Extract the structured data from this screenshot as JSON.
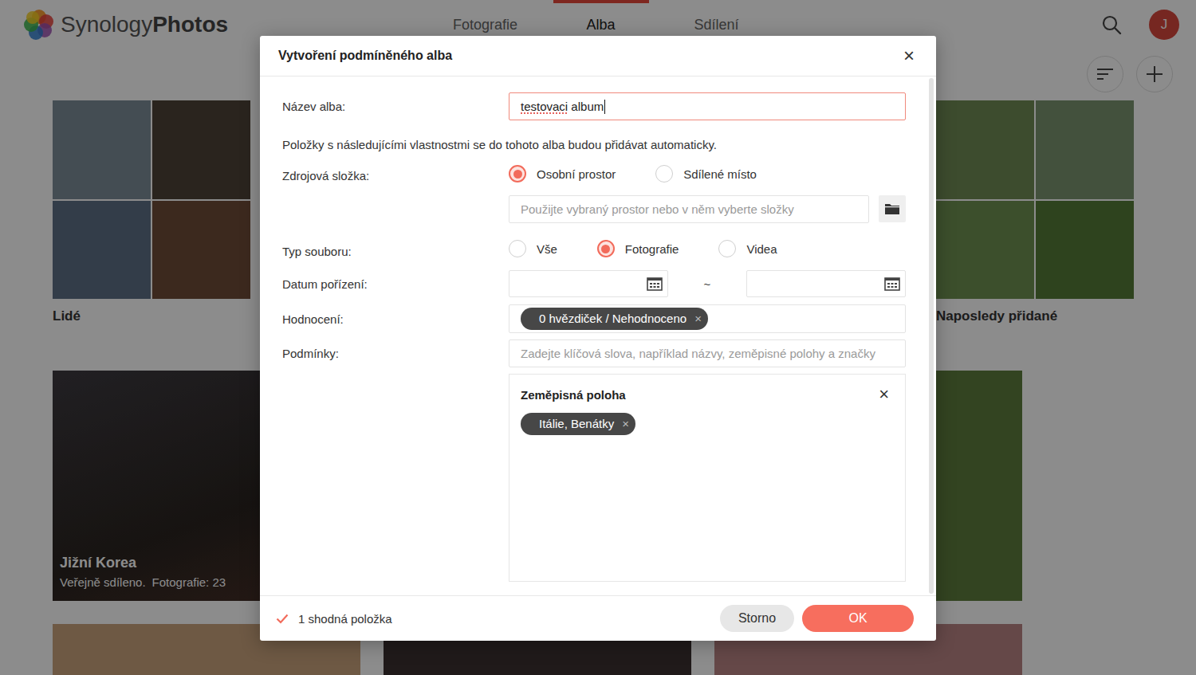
{
  "app": {
    "logo_light": "Synology",
    "logo_bold": "Photos",
    "avatar": "J"
  },
  "tabs": [
    {
      "label": "Fotografie",
      "selected": false
    },
    {
      "label": "Alba",
      "selected": true
    },
    {
      "label": "Sdílení",
      "selected": false
    }
  ],
  "albums": {
    "top": [
      {
        "kind": "mosaic",
        "title": "Lidé"
      },
      {
        "kind": "hidden"
      },
      {
        "kind": "hidden"
      },
      {
        "kind": "hidden"
      },
      {
        "kind": "mosaic",
        "title": "Naposledy přidané"
      }
    ],
    "cards": [
      {
        "kind": "cover",
        "title": "Jižní Korea",
        "meta": "Veřejně sdíleno.",
        "count": "Fotografie: 23"
      },
      {
        "kind": "hidden"
      },
      {
        "kind": "photo"
      },
      {
        "kind": "photo"
      },
      {
        "kind": "photo"
      },
      {
        "kind": "photo"
      }
    ]
  },
  "dialog": {
    "title": "Vytvoření podmíněného alba",
    "close": "×",
    "name": {
      "label": "Název alba:",
      "focused": true,
      "value": [
        {
          "text": "testovaci",
          "misspelled": true
        },
        {
          "text": " album",
          "misspelled": false
        }
      ]
    },
    "description": "Položky s následujícími vlastnostmi se do tohoto alba budou přidávat automaticky.",
    "source": {
      "label": "Zdrojová složka:",
      "options": [
        {
          "label": "Osobní prostor",
          "selected": true
        },
        {
          "label": "Sdílené místo",
          "selected": false
        }
      ],
      "folder_placeholder": "Použijte vybraný prostor nebo v něm vyberte složky"
    },
    "file_type": {
      "label": "Typ souboru:",
      "options": [
        {
          "label": "Vše",
          "selected": false
        },
        {
          "label": "Fotografie",
          "selected": true
        },
        {
          "label": "Videa",
          "selected": false
        }
      ]
    },
    "date": {
      "label": "Datum pořízení:",
      "from": "",
      "to": "",
      "separator": "~"
    },
    "rating": {
      "label": "Hodnocení:",
      "tags": [
        {
          "label": "0 hvězdiček / Nehodnoceno",
          "remove": "×"
        }
      ]
    },
    "conditions": {
      "label": "Podmínky:",
      "placeholder": "Zadejte klíčová slova, například názvy, zeměpisné polohy a značky",
      "groups": [
        {
          "title": "Zeměpisná poloha",
          "close": "×",
          "tags": [
            {
              "label": "Itálie, Benátky",
              "remove": "×"
            }
          ]
        }
      ]
    },
    "footer": {
      "matches": "1 shodná položka",
      "buttons": [
        {
          "label": "Storno",
          "kind": "secondary"
        },
        {
          "label": "OK",
          "kind": "primary"
        }
      ]
    }
  }
}
